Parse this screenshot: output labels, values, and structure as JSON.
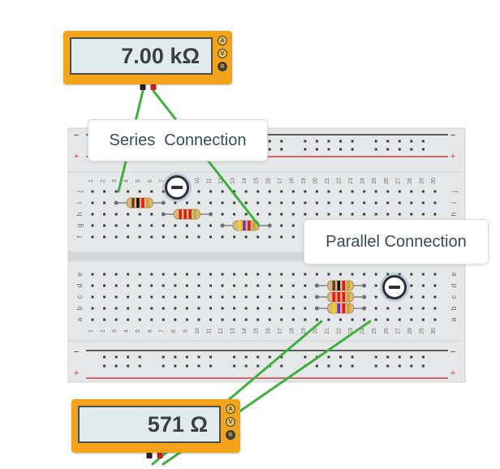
{
  "meter_top": {
    "reading": "7.00 kΩ",
    "modes": [
      "A",
      "V",
      "R"
    ],
    "active_mode": "R"
  },
  "meter_bottom": {
    "reading": "571 Ω",
    "modes": [
      "A",
      "V",
      "R"
    ],
    "active_mode": "R"
  },
  "annotations": {
    "series_label": "Series  Connection",
    "parallel_label": "Parallel Connection"
  },
  "breadboard": {
    "row_letters_top": [
      "j",
      "i",
      "h",
      "g",
      "f"
    ],
    "row_letters_bottom": [
      "e",
      "d",
      "c",
      "b",
      "a"
    ],
    "rail_minus": "−",
    "rail_plus": "+",
    "column_count": 30
  },
  "colors": {
    "board": "#e6e7e8",
    "wire": "#3db03d",
    "meter": "#f3a41a",
    "rail_red": "#d33b3b",
    "rail_black": "#2b2b2b"
  },
  "icons": {
    "remove_button": "minus-circle-icon"
  }
}
